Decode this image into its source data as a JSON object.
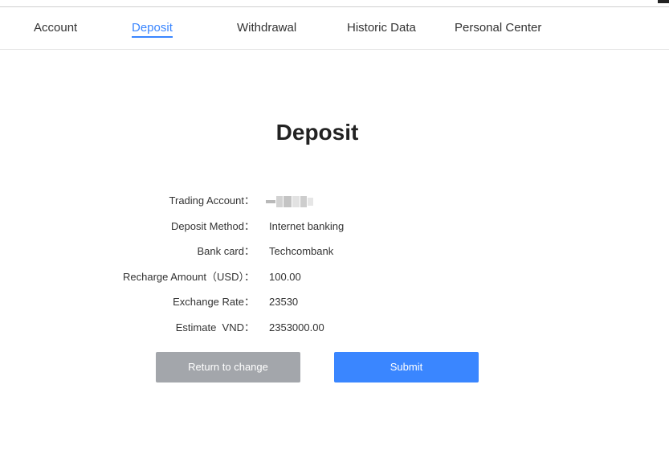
{
  "nav": {
    "items": [
      {
        "label": "Account",
        "active": false
      },
      {
        "label": "Deposit",
        "active": true
      },
      {
        "label": "Withdrawal",
        "active": false
      },
      {
        "label": "Historic Data",
        "active": false
      },
      {
        "label": "Personal Center",
        "active": false
      }
    ]
  },
  "page": {
    "title": "Deposit"
  },
  "details": [
    {
      "label": "Trading Account：",
      "value": ""
    },
    {
      "label": "Deposit Method：",
      "value": "Internet banking"
    },
    {
      "label": "Bank card：",
      "value": "Techcombank"
    },
    {
      "label": "Recharge Amount（USD）：",
      "value": "100.00"
    },
    {
      "label": "Exchange Rate：",
      "value": "23530"
    },
    {
      "label": "Estimate  VND：",
      "value": "2353000.00"
    }
  ],
  "buttons": {
    "return_label": "Return to change",
    "submit_label": "Submit"
  },
  "colors": {
    "accent": "#3a86ff",
    "secondary_button": "#a3a6ab"
  }
}
